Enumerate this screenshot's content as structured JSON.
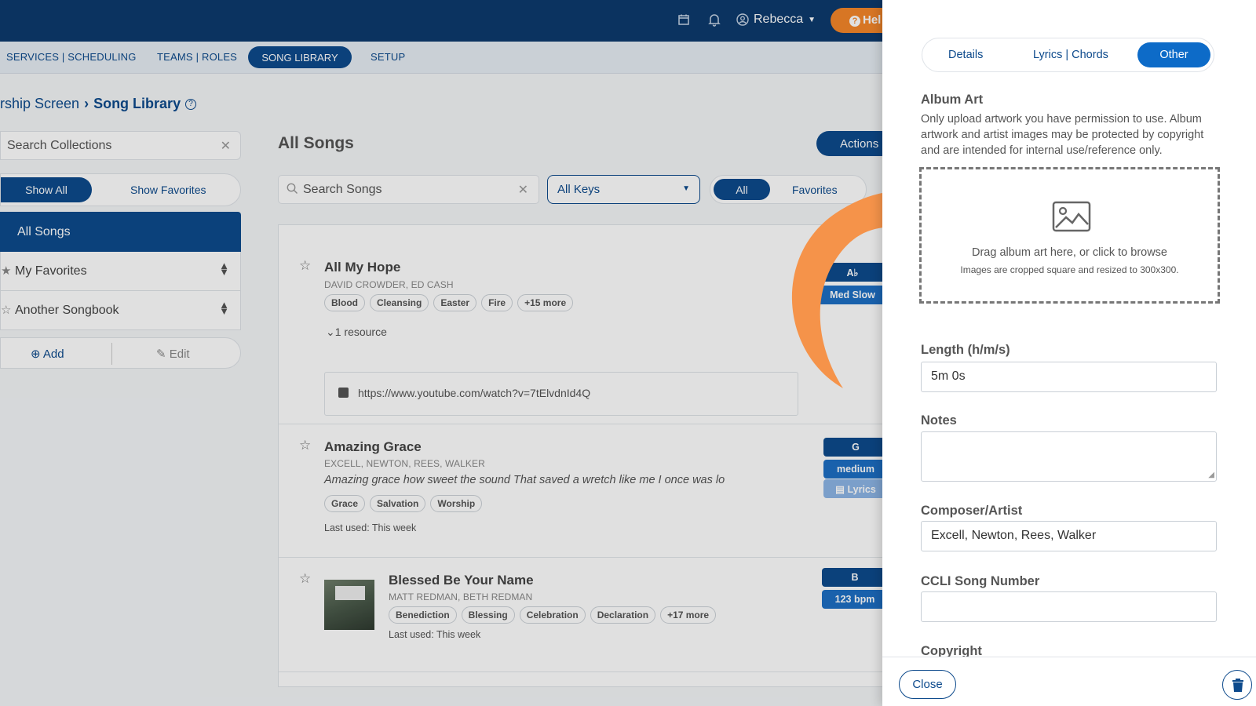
{
  "topbar": {
    "user_name": "Rebecca",
    "help_label": "Hel"
  },
  "nav": {
    "items": [
      "SERVICES | SCHEDULING",
      "TEAMS | ROLES",
      "SONG LIBRARY",
      "SETUP"
    ]
  },
  "breadcrumb": {
    "parent": "rship Screen",
    "current": "Song Library"
  },
  "collections": {
    "search_placeholder": "Search Collections",
    "show_all": "Show All",
    "show_favorites": "Show Favorites",
    "items": [
      "All Songs",
      "My Favorites",
      "Another Songbook"
    ],
    "add_label": "Add",
    "edit_label": "Edit"
  },
  "songs_panel": {
    "title": "All Songs",
    "actions_label": "Actions",
    "search_placeholder": "Search Songs",
    "keys_selected": "All Keys",
    "filter_all": "All",
    "filter_favorites": "Favorites"
  },
  "songs": [
    {
      "title": "All My Hope",
      "artists": "DAVID CROWDER, ED CASH",
      "tags": [
        "Blood",
        "Cleansing",
        "Easter",
        "Fire",
        "+15 more"
      ],
      "resource_toggle": "1 resource",
      "resource_url": "https://www.youtube.com/watch?v=7tElvdnId4Q",
      "key": "A♭",
      "tempo": "Med Slow"
    },
    {
      "title": "Amazing Grace",
      "artists": "EXCELL, NEWTON, REES, WALKER",
      "lyric": "Amazing grace how sweet the sound That saved a wretch like me I once was lo",
      "tags": [
        "Grace",
        "Salvation",
        "Worship"
      ],
      "last_used": "Last used: This week",
      "key": "G",
      "tempo": "medium",
      "lyrics_label": "Lyrics"
    },
    {
      "title": "Blessed Be Your Name",
      "artists": "MATT REDMAN, BETH REDMAN",
      "tags": [
        "Benediction",
        "Blessing",
        "Celebration",
        "Declaration",
        "+17 more"
      ],
      "last_used": "Last used: This week",
      "key": "B",
      "tempo": "123 bpm"
    }
  ],
  "drawer": {
    "tabs": [
      "Details",
      "Lyrics | Chords",
      "Other"
    ],
    "album_art_label": "Album Art",
    "album_art_desc": "Only upload artwork you have permission to use. Album artwork and artist images may be protected by copyright and are intended for internal use/reference only.",
    "dropzone_main": "Drag album art here, or click to browse",
    "dropzone_sub": "Images are cropped square and resized to 300x300.",
    "length_label": "Length (h/m/s)",
    "length_value": "5m 0s",
    "notes_label": "Notes",
    "notes_value": "",
    "composer_label": "Composer/Artist",
    "composer_value": "Excell, Newton, Rees, Walker",
    "ccli_label": "CCLI Song Number",
    "ccli_value": "",
    "copyright_label": "Copyright",
    "close_label": "Close"
  },
  "colors": {
    "brand_dark": "#0d3b6e",
    "brand": "#0d4a8c",
    "accent_orange": "#f5872a",
    "active_tab": "#0d6bc8"
  }
}
